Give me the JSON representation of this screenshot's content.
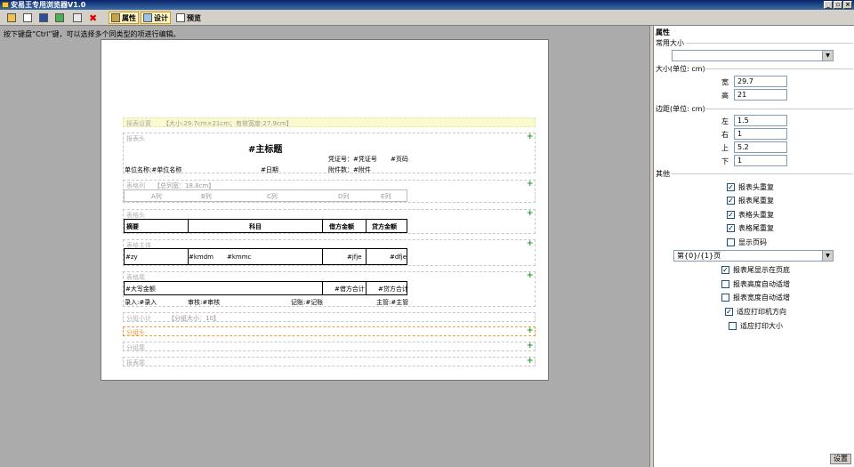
{
  "window": {
    "title": "安易王专用浏览器V1.0"
  },
  "toolbar": {
    "properties": "属性",
    "design": "设计",
    "preview": "预览"
  },
  "hint": "按下键盘“Ctrl”键，可以选择多个同类型的项进行编辑。",
  "report": {
    "settings_band": "报表设置",
    "settings_info": "【大小:29.7cm×21cm；有效宽度:27.9cm】",
    "header_band": "报表头",
    "main_title": "#主标题",
    "voucher_label": "凭证号：#凭证号",
    "page_code": "#页码",
    "unit_label": "单位名称:#单位名称",
    "date_label": "#日期",
    "attach_label": "附件数：#附件",
    "colhead_band": "表格列",
    "colhead_info": "【总列宽：18.8cm】",
    "columns": [
      "A列",
      "B列",
      "C列",
      "D列",
      "E列"
    ],
    "tablehead_band": "表格头",
    "table_headers": [
      "摘要",
      "科目",
      "借方金额",
      "贷方金额"
    ],
    "tablebody_band": "表格主体",
    "table_body": [
      "#zy",
      "#kmdm",
      "#kmmc",
      "#jfje",
      "#dfje"
    ],
    "tablefoot_band": "表格尾",
    "foot_total": "#大写金额",
    "foot_debit": "#借方合计",
    "foot_credit": "#贷方合计",
    "sign_entry": "录入:#录入",
    "sign_review": "审核:#审核",
    "sign_post": "记账:#记账",
    "sign_manager": "主管:#主管",
    "group_subtotal": "分组小计",
    "group_size": "【分组大小：10】",
    "group_head": "分组头",
    "group_foot": "分组尾",
    "report_foot": "报表尾"
  },
  "panel": {
    "title": "属性",
    "common_size": "常用大小",
    "size_section": "大小(单位: cm)",
    "width_label": "宽",
    "width_value": "29.7",
    "height_label": "高",
    "height_value": "21",
    "margin_section": "边距(单位: cm)",
    "left_label": "左",
    "left_value": "1.5",
    "right_label": "右",
    "right_value": "1",
    "top_label": "上",
    "top_value": "5.2",
    "bottom_label": "下",
    "bottom_value": "1",
    "other_section": "其他",
    "checks1": [
      {
        "label": "报表头重复",
        "checked": true
      },
      {
        "label": "报表尾重复",
        "checked": true
      },
      {
        "label": "表格头重复",
        "checked": true
      },
      {
        "label": "表格尾重复",
        "checked": true
      },
      {
        "label": "显示页码",
        "checked": false
      }
    ],
    "page_format": "第{0}/{1}页",
    "checks2": [
      {
        "label": "报表尾显示在页底",
        "checked": true
      },
      {
        "label": "报表高度自动适增",
        "checked": false
      },
      {
        "label": "报表宽度自动适增",
        "checked": false
      },
      {
        "label": "适应打印机方向",
        "checked": true
      },
      {
        "label": "适应打印大小",
        "checked": false
      }
    ],
    "set_button": "设置"
  }
}
